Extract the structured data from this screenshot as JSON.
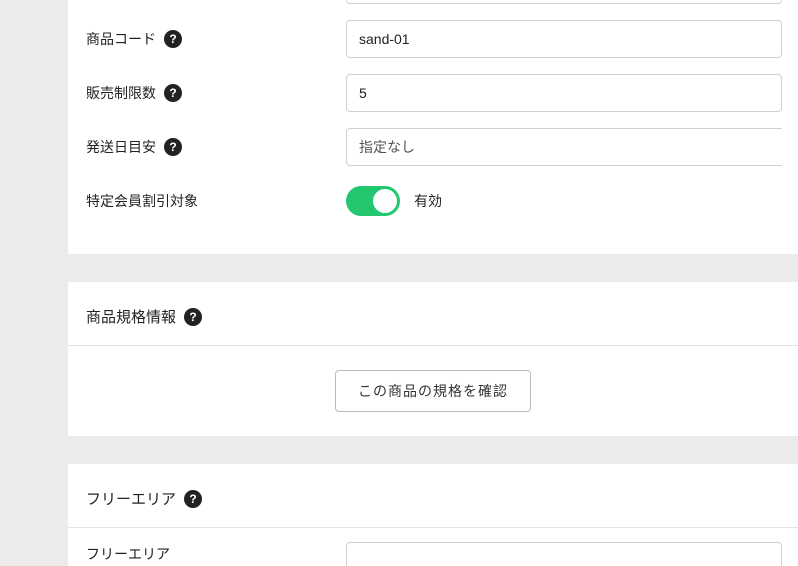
{
  "fields": {
    "product_code": {
      "label": "商品コード",
      "value": "sand-01"
    },
    "sales_limit": {
      "label": "販売制限数",
      "value": "5"
    },
    "delivery_estimate": {
      "label": "発送日目安",
      "value": "指定なし"
    },
    "member_discount": {
      "label": "特定会員割引対象",
      "status": "有効"
    }
  },
  "spec_section": {
    "title": "商品規格情報",
    "button": "この商品の規格を確認"
  },
  "free_area": {
    "title": "フリーエリア",
    "label": "フリーエリア",
    "value": ""
  }
}
